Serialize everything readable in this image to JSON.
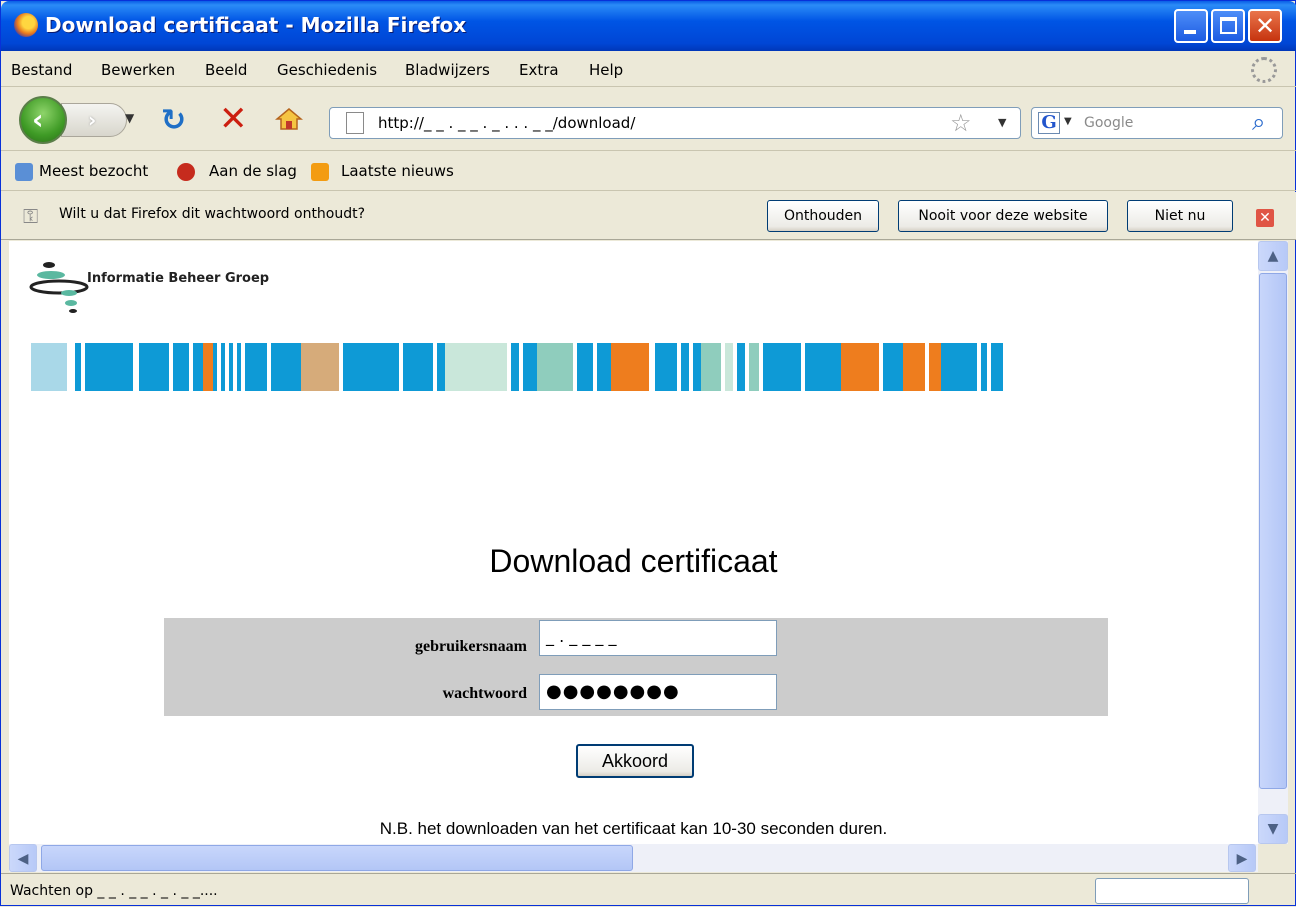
{
  "window": {
    "title": "Download certificaat - Mozilla Firefox"
  },
  "menu": [
    "Bestand",
    "Bewerken",
    "Beeld",
    "Geschiedenis",
    "Bladwijzers",
    "Extra",
    "Help"
  ],
  "nav": {
    "url": "http://_ _ . _ _ . _ . . . _ _/download/",
    "search_placeholder": "Google"
  },
  "bookmarks": [
    "Meest bezocht",
    "Aan de slag",
    "Laatste nieuws"
  ],
  "notify": {
    "text": "Wilt u dat Firefox dit wachtwoord onthoudt?",
    "remember": "Onthouden",
    "never": "Nooit voor deze website",
    "not_now": "Niet nu"
  },
  "page": {
    "logo_text": "Informatie Beheer Groep",
    "title": "Download certificaat",
    "username_label": "gebruikersnaam",
    "username_value": "_ . _ _ _ _",
    "password_label": "wachtwoord",
    "password_value": "●●●●●●●●",
    "submit_label": "Akkoord",
    "note": "N.B. het downloaden van het certificaat kan 10-30 seconden duren."
  },
  "status": {
    "text": "Wachten op _ _ . _ _ . _ . _ _...."
  },
  "colors": {
    "blue": "#0e9ad6",
    "lightblue": "#a9d8e8",
    "orange": "#ee7d1e",
    "tan": "#d6ab7a",
    "mint": "#8fcdbd",
    "palemint": "#c9e7da",
    "white": "#ffffff"
  }
}
